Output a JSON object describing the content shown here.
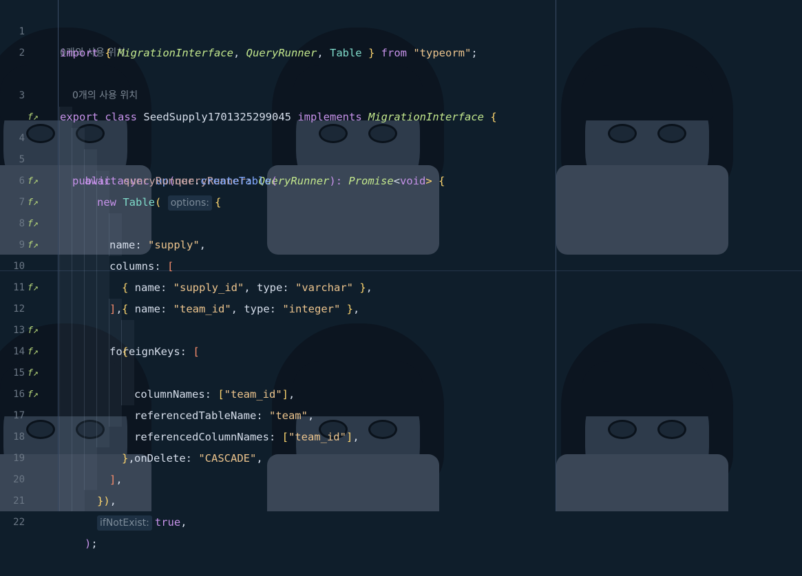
{
  "editor": {
    "usage_hint": "0개의 사용 위치",
    "gutter_icon": "function-icon",
    "lines": [
      {
        "n": "1",
        "gutter": false
      },
      {
        "n": "2",
        "gutter": false
      },
      {
        "n": "3",
        "gutter": false
      },
      {
        "n": "4",
        "gutter": true
      },
      {
        "n": "5",
        "gutter": false
      },
      {
        "n": "6",
        "gutter": false
      },
      {
        "n": "7",
        "gutter": true
      },
      {
        "n": "8",
        "gutter": true
      },
      {
        "n": "9",
        "gutter": true
      },
      {
        "n": "10",
        "gutter": true
      },
      {
        "n": "11",
        "gutter": false
      },
      {
        "n": "12",
        "gutter": true
      },
      {
        "n": "13",
        "gutter": false
      },
      {
        "n": "14",
        "gutter": true
      },
      {
        "n": "15",
        "gutter": true
      },
      {
        "n": "16",
        "gutter": true
      },
      {
        "n": "17",
        "gutter": true
      },
      {
        "n": "18",
        "gutter": false
      },
      {
        "n": "19",
        "gutter": false
      },
      {
        "n": "20",
        "gutter": false
      },
      {
        "n": "21",
        "gutter": false
      },
      {
        "n": "22",
        "gutter": false
      }
    ],
    "tokens": {
      "l1": [
        "import",
        " { ",
        "MigrationInterface",
        ", ",
        "QueryRunner",
        ", ",
        "Table",
        " } ",
        "from",
        " ",
        "\"typeorm\"",
        ";"
      ],
      "l3": [
        "export",
        " ",
        "class",
        " ",
        "SeedSupply1701325299045",
        " ",
        "implements",
        " ",
        "MigrationInterface",
        " {"
      ],
      "l4": [
        "public",
        " ",
        "async",
        " ",
        "up",
        "(",
        "queryRunner",
        ": ",
        "QueryRunner",
        "): ",
        "Promise",
        "<",
        "void",
        "> {"
      ],
      "l5": [
        "await",
        " ",
        "queryRunner",
        ".",
        "createTable",
        "("
      ],
      "l6": [
        "new",
        " ",
        "Table",
        "(",
        "options:",
        "{"
      ],
      "l7": [
        "name",
        ": ",
        "\"supply\"",
        ","
      ],
      "l8": [
        "columns",
        ": ",
        "["
      ],
      "l9": [
        "{ ",
        "name",
        ": ",
        "\"supply_id\"",
        ", ",
        "type",
        ": ",
        "\"varchar\"",
        " }",
        ","
      ],
      "l10": [
        "{ ",
        "name",
        ": ",
        "\"team_id\"",
        ", ",
        "type",
        ": ",
        "\"integer\"",
        " }",
        ","
      ],
      "l11": [
        "]",
        ","
      ],
      "l12": [
        "foreignKeys",
        ": ",
        "["
      ],
      "l13": [
        "{"
      ],
      "l14": [
        "columnNames",
        ": ",
        "[",
        "\"team_id\"",
        "]",
        ","
      ],
      "l15": [
        "referencedTableName",
        ": ",
        "\"team\"",
        ","
      ],
      "l16": [
        "referencedColumnNames",
        ": ",
        "[",
        "\"team_id\"",
        "]",
        ","
      ],
      "l17": [
        "onDelete",
        ": ",
        "\"CASCADE\"",
        ","
      ],
      "l18": [
        "}",
        ","
      ],
      "l19": [
        "]",
        ","
      ],
      "l20": [
        "})",
        ","
      ],
      "l21": [
        "ifNotExist:",
        "true",
        ","
      ],
      "l22": [
        ")",
        ";"
      ]
    }
  }
}
